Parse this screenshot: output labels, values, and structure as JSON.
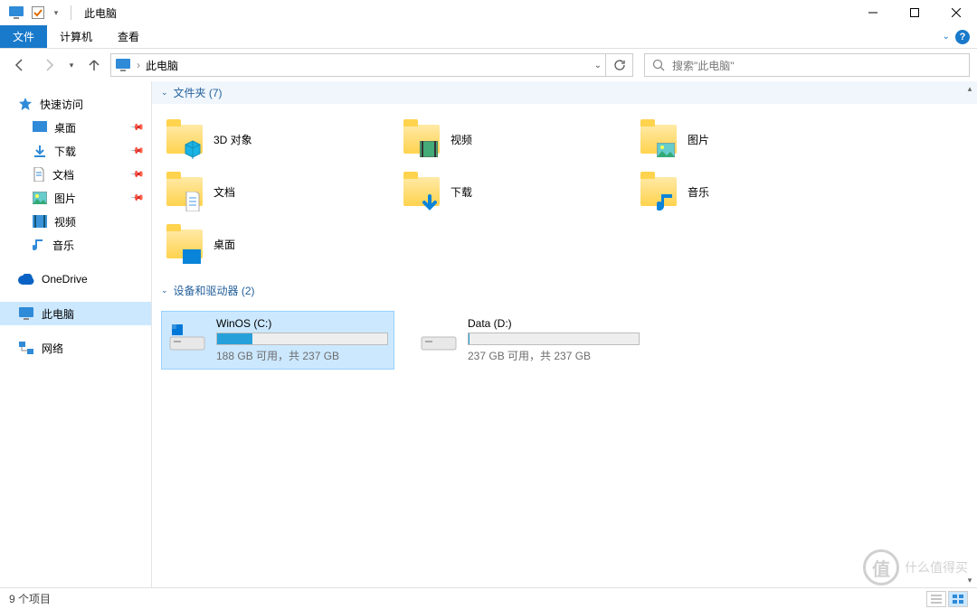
{
  "window": {
    "title": "此电脑",
    "controls": {
      "min": "—",
      "max": "☐",
      "close": "✕"
    }
  },
  "ribbon": {
    "file": "文件",
    "tabs": [
      "计算机",
      "查看"
    ]
  },
  "nav": {
    "address": "此电脑",
    "search_placeholder": "搜索\"此电脑\""
  },
  "sidebar": {
    "quick": "快速访问",
    "items": [
      {
        "label": "桌面",
        "icon": "desktop"
      },
      {
        "label": "下载",
        "icon": "download"
      },
      {
        "label": "文档",
        "icon": "document"
      },
      {
        "label": "图片",
        "icon": "picture"
      },
      {
        "label": "视频",
        "icon": "video"
      },
      {
        "label": "音乐",
        "icon": "music"
      }
    ],
    "onedrive": "OneDrive",
    "thispc": "此电脑",
    "network": "网络"
  },
  "content": {
    "group_folders": "文件夹 (7)",
    "folders": [
      {
        "label": "3D 对象"
      },
      {
        "label": "视频"
      },
      {
        "label": "图片"
      },
      {
        "label": "文档"
      },
      {
        "label": "下载"
      },
      {
        "label": "音乐"
      },
      {
        "label": "桌面"
      }
    ],
    "group_drives": "设备和驱动器 (2)",
    "drives": [
      {
        "label": "WinOS (C:)",
        "sub": "188 GB 可用，共 237 GB",
        "fill": 21
      },
      {
        "label": "Data (D:)",
        "sub": "237 GB 可用，共 237 GB",
        "fill": 0
      }
    ]
  },
  "status": {
    "text": "9 个项目"
  },
  "watermark": "什么值得买"
}
